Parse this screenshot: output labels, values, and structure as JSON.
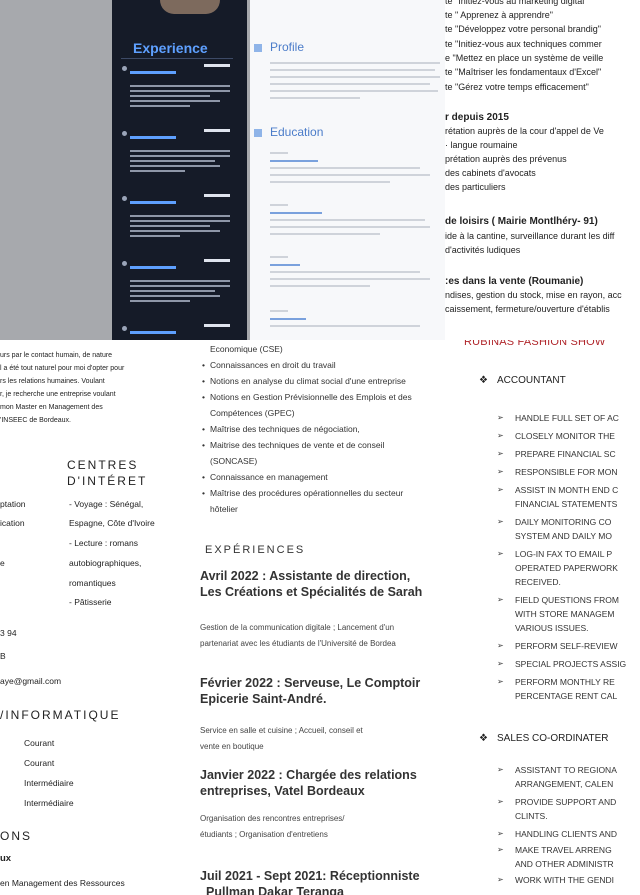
{
  "top_left": {
    "experience_title": "Experience"
  },
  "top_middle": {
    "profile_title": "Profile",
    "education_title": "Education"
  },
  "top_right": {
    "lines": [
      "te \"Initiez-vous au marketing digital\"",
      "te \" Apprenez à apprendre\"",
      "te \"Développez votre personal brandig\"",
      "te \"Initiez-vous aux techniques commer",
      "e \"Mettez en place un système de veille",
      "te \"Maîtriser les fondamentaux d'Excel\"",
      "te \"Gérez votre temps efficacement\""
    ],
    "since_title": "r depuis 2015",
    "since_lines": [
      "rétation auprès de la cour d'appel de Ve",
      "· langue roumaine",
      "prétation auprès des prévenus",
      "des cabinets d'avocats",
      "des particuliers"
    ],
    "leisure_title": "de loisirs ( Mairie Montlhéry- 91)",
    "leisure_lines": [
      "ide à la cantine, surveillance durant les diff",
      "d'activités ludiques"
    ],
    "sales_title": ":es dans la vente (Roumanie)",
    "sales_lines": [
      "ndises, gestion du stock, mise en rayon, acc",
      "caissement, fermeture/ouverture d'établis"
    ]
  },
  "mid_left": {
    "intro": [
      "urs par le contact humain, de nature",
      "l a été tout naturel pour moi d'opter pour",
      "rs les relations humaines. Voulant",
      "r, je recherche une entreprise voulant",
      "mon Master en Management des",
      "'INSEEC de Bordeaux."
    ],
    "interests_title_1": "CENTRES",
    "interests_title_2": "D'INTÉRET",
    "interests": [
      "- Voyage : Sénégal,",
      "Espagne, Côte d'Ivoire",
      "- Lecture : romans",
      "autobiographiques,",
      "romantiques",
      "- Pâtisserie"
    ],
    "left_fragments": [
      "ptation",
      "ication",
      "e"
    ],
    "contact": [
      "3 94",
      "B",
      "aye@gmail.com"
    ],
    "informatique_title": "/INFORMATIQUE",
    "levels": [
      "Courant",
      "Courant",
      "Intermédiaire",
      "Intermédiaire"
    ],
    "ons_title": "ONS",
    "ux": "ux",
    "bottom_line": "en Management des Ressources"
  },
  "mid_center": {
    "skills": [
      "Economique (CSE)",
      "Connaissances en droit du travail",
      "Notions en analyse du climat social d'une entreprise",
      "Notions en Gestion Prévisionnelle des Emplois et des",
      "Compétences (GPEC)",
      "Maîtrise des techniques de négociation,",
      "Maitrise des techniques de vente et de conseil",
      "(SONCASE)",
      "Connaissance en management",
      "Maîtrise des procédures opérationnelles du secteur",
      "hôtelier"
    ],
    "experiences_title": "EXPÉRIENCES",
    "jobs": [
      {
        "title1": "Avril 2022 : Assistante de direction,",
        "title2": "Les Créations et Spécialités de Sarah",
        "desc1": "Gestion de la communication digitale ; Lancement d'un",
        "desc2": "partenariat avec les étudiants de l'Université de Bordea"
      },
      {
        "title1": "Février 2022 : Serveuse, Le Comptoir",
        "title2": "Epicerie Saint-André.",
        "desc1": "Service en salle et cuisine ; Accueil, conseil et",
        "desc2": "vente en boutique"
      },
      {
        "title1": "Janvier 2022 : Chargée des relations",
        "title2": "entreprises, Vatel Bordeaux",
        "desc1": "Organisation des rencontres entreprises/",
        "desc2": "étudiants ; Organisation d'entretiens"
      },
      {
        "title1": "Juil 2021 - Sept 2021: Réceptionniste",
        "title2": "Pullman Dakar Teranga"
      }
    ]
  },
  "mid_right": {
    "header": "RUBINAS FASHION SHOW",
    "role1": "ACCOUNTANT",
    "role1_items": [
      "HANDLE FULL SET OF AC",
      "CLOSELY MONITOR THE",
      "PREPARE FINANCIAL SC",
      " RESPONSIBLE FOR MON",
      "ASSIST IN MONTH END C",
      "FINANCIAL STATEMENTS",
      "DAILY MONITORING CO",
      "SYSTEM AND DAILY MO",
      "LOG-IN FAX TO EMAIL P",
      "OPERATED PAPERWORK",
      "RECEIVED.",
      "FIELD QUESTIONS FROM",
      "WITH STORE MANAGEM",
      "VARIOUS ISSUES.",
      "PERFORM SELF-REVIEW",
      "SPECIAL PROJECTS ASSIG",
      "PERFORM MONTHLY RE",
      "PERCENTAGE RENT CAL"
    ],
    "role2": "SALES CO-ORDINATER",
    "role2_items": [
      "ASSISTANT TO REGIONA",
      "ARRANGEMENT, CALEN",
      "PROVIDE SUPPORT AND",
      "CLINTS.",
      "HANDLING CLIENTS AND",
      " MAKE TRAVEL ARRENG",
      "AND OTHER ADMINISTR",
      "WORK WITH THE GENDI"
    ]
  }
}
